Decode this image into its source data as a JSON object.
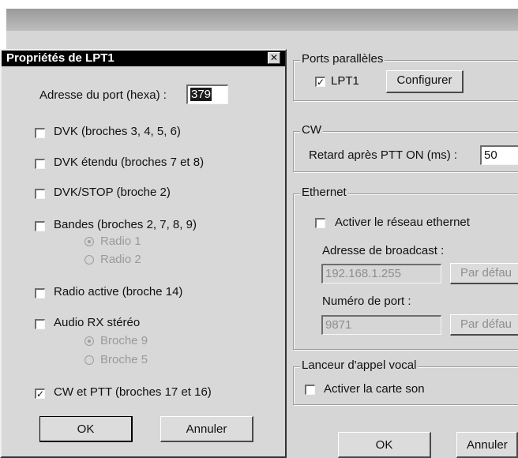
{
  "dialog": {
    "title": "Propriétés de LPT1",
    "port_address_label": "Adresse du port (hexa) :",
    "port_address_value": "379",
    "options": [
      {
        "label": "DVK (broches 3, 4, 5, 6)",
        "checked": false
      },
      {
        "label": "DVK étendu (broches 7 et 8)",
        "checked": false
      },
      {
        "label": "DVK/STOP (broche 2)",
        "checked": false
      },
      {
        "label": "Bandes (broches 2, 7, 8, 9)",
        "checked": false
      },
      {
        "label": "Radio active (broche 14)",
        "checked": false
      },
      {
        "label": "Audio RX stéréo",
        "checked": false
      },
      {
        "label": "CW et PTT (broches 17 et 16)",
        "checked": true
      }
    ],
    "bandes_radios": [
      "Radio 1",
      "Radio 2"
    ],
    "audio_radios": [
      "Broche 9",
      "Broche 5"
    ],
    "ok_label": "OK",
    "cancel_label": "Annuler"
  },
  "parent": {
    "parallel_ports": {
      "legend": "Ports parallèles",
      "lpt1_label": "LPT1",
      "lpt1_checked": true,
      "configure_label": "Configurer"
    },
    "cw": {
      "legend": "CW",
      "delay_label": "Retard après PTT ON (ms) :",
      "delay_value": "50"
    },
    "ethernet": {
      "legend": "Ethernet",
      "enable_label": "Activer le réseau ethernet",
      "broadcast_label": "Adresse de broadcast :",
      "broadcast_value": "192.168.1.255",
      "default_label_1": "Par défau",
      "port_label": "Numéro de port :",
      "port_value": "9871",
      "default_label_2": "Par défau"
    },
    "vocal": {
      "legend": "Lanceur d'appel vocal",
      "sound_card_label": "Activer la carte son"
    },
    "ok_label": "OK",
    "cancel_label": "Annuler"
  }
}
